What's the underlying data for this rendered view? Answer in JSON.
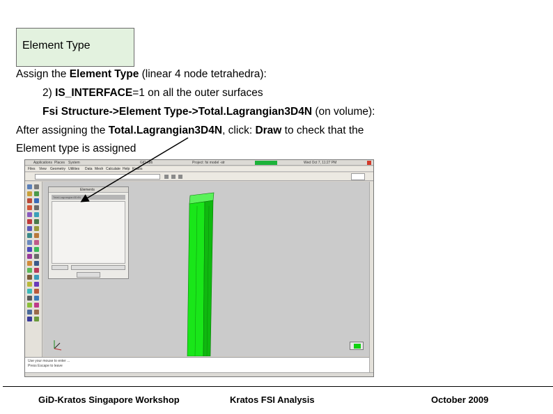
{
  "slide": {
    "heading": "Element Type",
    "line1": {
      "prefix": "Assign the ",
      "bold": "Element Type",
      "suffix": " (linear 4 node tetrahedra):"
    },
    "line2": {
      "prefix": "2) ",
      "bold": "IS_INTERFACE",
      "suffix": "=1 on all the outer surfaces"
    },
    "line3": {
      "bold": "Fsi Structure->Element Type->Total.Lagrangian3D4N",
      "suffix": " (on volume):"
    },
    "line4": {
      "prefix": "After assigning the ",
      "bold1": "Total.Lagrangian3D4N",
      "mid": ", click: ",
      "bold2": "Draw",
      "suffix": " to check that the"
    },
    "line5": "Element type is assigned"
  },
  "screenshot": {
    "topbar": {
      "applications": "Applications",
      "places": "Places",
      "system": "System",
      "window_title": "GiD-x86",
      "project": "Project: fsi model -str",
      "clock": "Wed Oct  7, 11:27 PM"
    },
    "menu": [
      "Files",
      "View",
      "Geometry",
      "Utilities",
      "Data",
      "Mesh",
      "Calculate",
      "Help",
      "Kratos"
    ],
    "panel": {
      "title": "Elements",
      "item": "Total.Lagrangian3D4N"
    },
    "command_lines": [
      "Use your mouse to enter ...",
      "Press Escape to leave"
    ],
    "colors": {
      "column_green": "#19e619",
      "column_dark": "#0fb80f",
      "topbar_green": "#1db33a"
    }
  },
  "footer": {
    "left": "GiD-Kratos Singapore Workshop",
    "center": "Kratos FSI Analysis",
    "right": "October 2009"
  }
}
